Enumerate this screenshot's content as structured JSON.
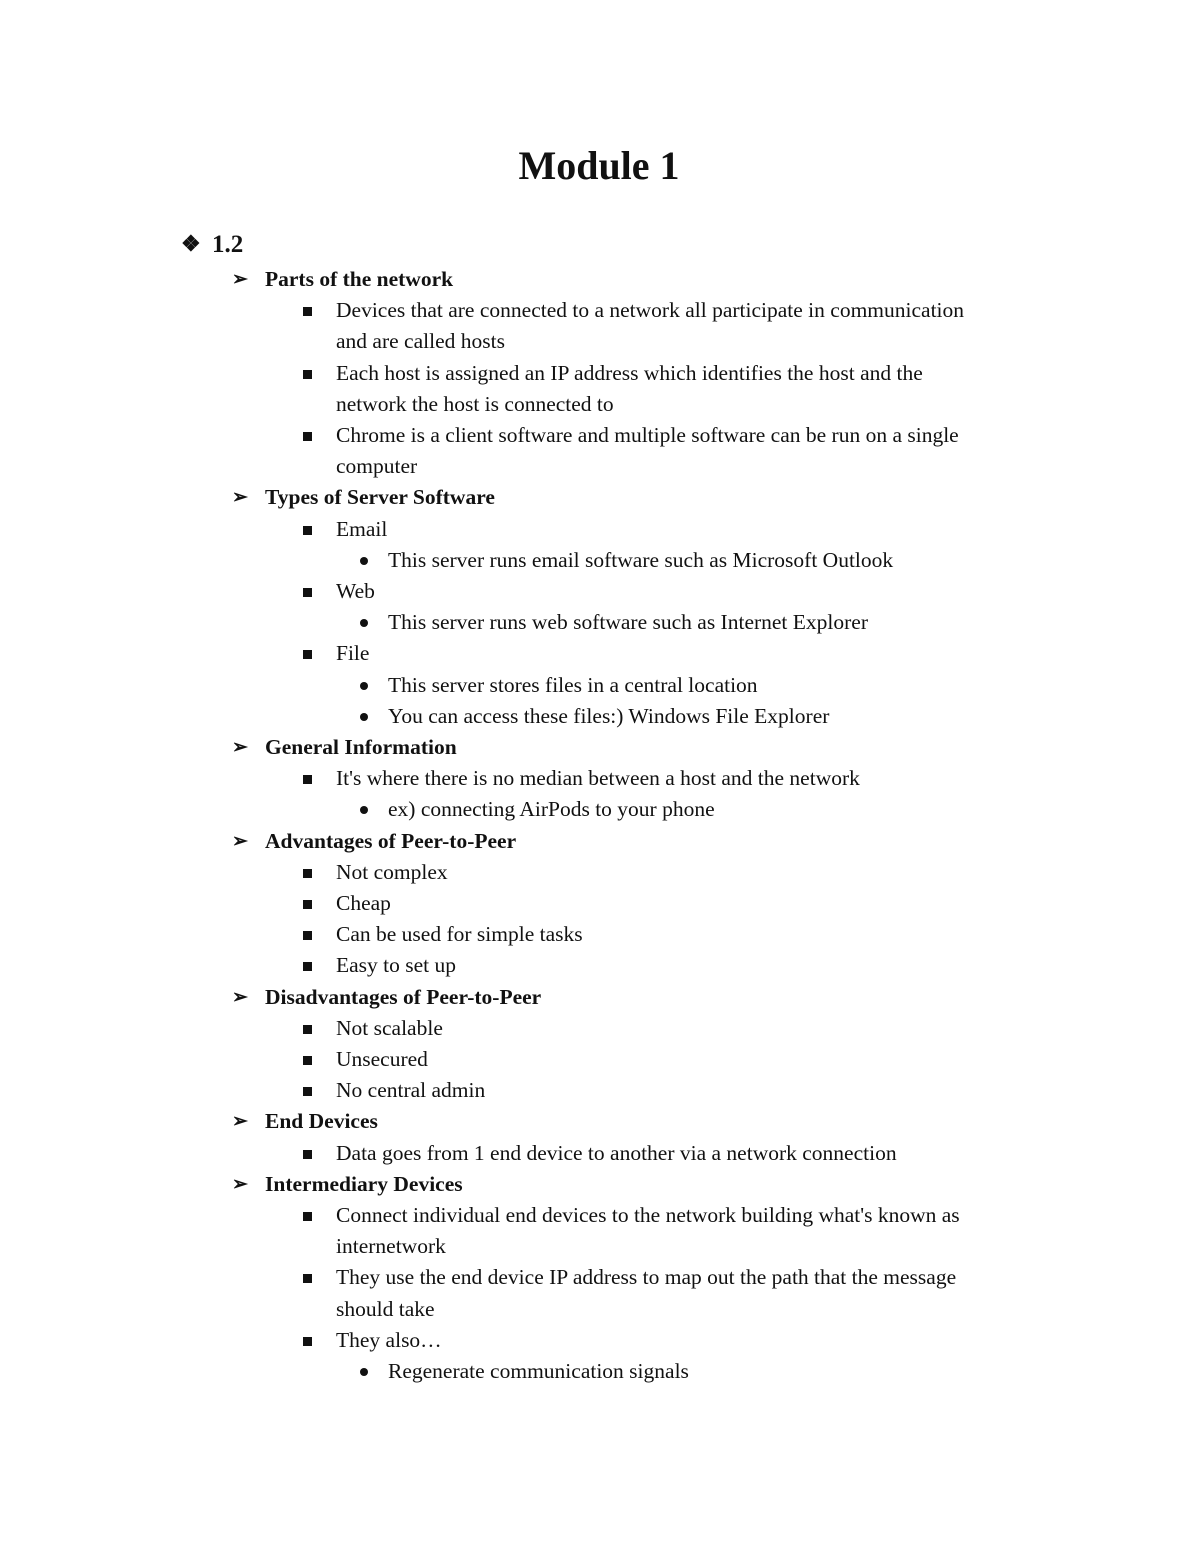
{
  "document": {
    "title": "Module 1",
    "sections": [
      {
        "marker": "diamond-bullet",
        "label": "1.2",
        "subsections": [
          {
            "heading": "Parts of the network",
            "items": [
              {
                "text_lines": [
                  "Devices that are connected to a network all participate in communication",
                  "and are called hosts"
                ],
                "sub": []
              },
              {
                "text_lines": [
                  "Each host is assigned an IP address which identifies the host and the",
                  "network the host is connected to"
                ],
                "sub": []
              },
              {
                "text_lines": [
                  "Chrome is a client software and multiple software can be run on a single",
                  "computer"
                ],
                "sub": []
              }
            ]
          },
          {
            "heading": "Types of Server Software",
            "items": [
              {
                "text_lines": [
                  "Email"
                ],
                "sub": [
                  "This server runs email software such as Microsoft Outlook"
                ]
              },
              {
                "text_lines": [
                  "Web"
                ],
                "sub": [
                  "This server runs web software such as Internet Explorer"
                ]
              },
              {
                "text_lines": [
                  "File"
                ],
                "sub": [
                  "This server stores files in a central location",
                  "You can access these files:) Windows File Explorer"
                ]
              }
            ]
          },
          {
            "heading": "General Information",
            "items": [
              {
                "text_lines": [
                  "It's where there is no median between a host and the network"
                ],
                "sub": [
                  "ex) connecting AirPods to your phone"
                ]
              }
            ]
          },
          {
            "heading": "Advantages of Peer-to-Peer",
            "items": [
              {
                "text_lines": [
                  "Not complex"
                ],
                "sub": []
              },
              {
                "text_lines": [
                  "Cheap"
                ],
                "sub": []
              },
              {
                "text_lines": [
                  "Can be used for simple tasks"
                ],
                "sub": []
              },
              {
                "text_lines": [
                  "Easy to set up"
                ],
                "sub": []
              }
            ]
          },
          {
            "heading": "Disadvantages of Peer-to-Peer",
            "items": [
              {
                "text_lines": [
                  "Not scalable"
                ],
                "sub": []
              },
              {
                "text_lines": [
                  "Unsecured"
                ],
                "sub": []
              },
              {
                "text_lines": [
                  "No central admin"
                ],
                "sub": []
              }
            ]
          },
          {
            "heading": "End Devices",
            "items": [
              {
                "text_lines": [
                  "Data goes from 1 end device to another via a network connection"
                ],
                "sub": []
              }
            ]
          },
          {
            "heading": "Intermediary Devices",
            "items": [
              {
                "text_lines": [
                  "Connect individual end devices to the network building what's known as",
                  "internetwork"
                ],
                "sub": []
              },
              {
                "text_lines": [
                  "They use the end device IP address to map out the path that the message",
                  "should take"
                ],
                "sub": []
              },
              {
                "text_lines": [
                  "They also…"
                ],
                "sub": [
                  "Regenerate communication signals"
                ]
              }
            ]
          }
        ]
      }
    ]
  },
  "glyphs": {
    "level1": "❖",
    "level2": "➢"
  }
}
